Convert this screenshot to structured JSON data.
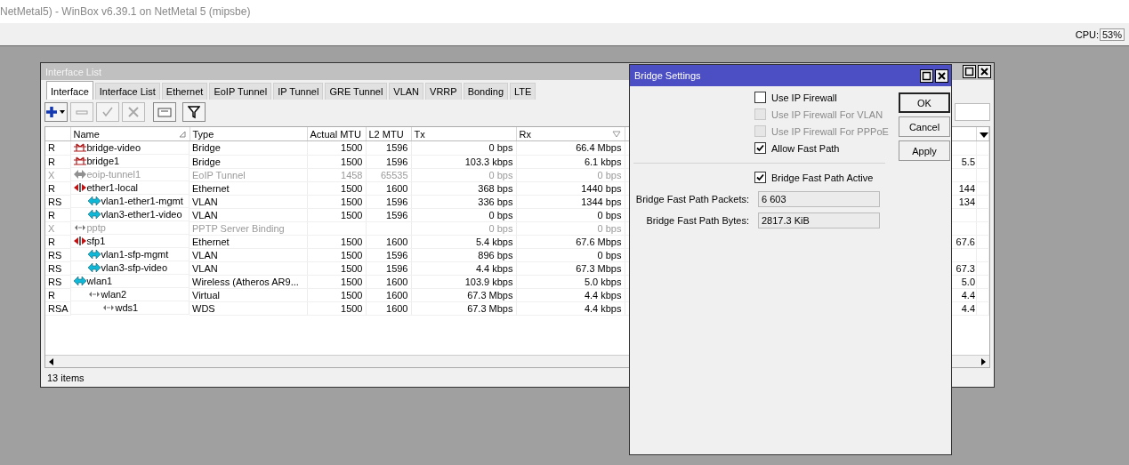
{
  "app_title": "NetMetal5) - WinBox v6.39.1 on NetMetal 5 (mipsbe)",
  "cpu": {
    "label": "CPU:",
    "value": "53%"
  },
  "interface_window": {
    "title": "Interface List",
    "tabs": [
      {
        "label": "Interface",
        "selected": true
      },
      {
        "label": "Interface List",
        "selected": false
      },
      {
        "label": "Ethernet",
        "selected": false
      },
      {
        "label": "EoIP Tunnel",
        "selected": false
      },
      {
        "label": "IP Tunnel",
        "selected": false
      },
      {
        "label": "GRE Tunnel",
        "selected": false
      },
      {
        "label": "VLAN",
        "selected": false
      },
      {
        "label": "VRRP",
        "selected": false
      },
      {
        "label": "Bonding",
        "selected": false
      },
      {
        "label": "LTE",
        "selected": false
      }
    ],
    "toolbar": [
      {
        "kind": "add",
        "disabled": false
      },
      {
        "kind": "remove",
        "disabled": true
      },
      {
        "kind": "enable",
        "disabled": true
      },
      {
        "kind": "disable",
        "disabled": true
      },
      {
        "kind": "comment",
        "disabled": false
      },
      {
        "kind": "filter",
        "disabled": false
      }
    ],
    "columns": [
      "Name",
      "Type",
      "Actual MTU",
      "L2 MTU",
      "Tx",
      "Rx"
    ],
    "rows": [
      {
        "flags": "R",
        "name": "bridge-video",
        "kind": "bridge",
        "disabled": false,
        "type": "Bridge",
        "actual_mtu": "1500",
        "l2_mtu": "1596",
        "tx": "0 bps",
        "rx": "66.4 Mbps"
      },
      {
        "flags": "R",
        "name": "bridge1",
        "kind": "bridge",
        "disabled": false,
        "type": "Bridge",
        "actual_mtu": "1500",
        "l2_mtu": "1596",
        "tx": "103.3 kbps",
        "rx": "6.1 kbps",
        "column_7": "5.5"
      },
      {
        "flags": "X",
        "name": "eoip-tunnel1",
        "kind": "tunnel",
        "disabled": true,
        "type": "EoIP Tunnel",
        "actual_mtu": "1458",
        "l2_mtu": "65535",
        "tx": "0 bps",
        "rx": "0 bps"
      },
      {
        "flags": "R",
        "name": "ether1-local",
        "kind": "ethernet",
        "disabled": false,
        "type": "Ethernet",
        "actual_mtu": "1500",
        "l2_mtu": "1600",
        "tx": "368 bps",
        "rx": "1440 bps",
        "column_7": "144",
        "children": [
          {
            "flags": "RS",
            "name": "vlan1-ether1-mgmt",
            "kind": "vlan",
            "disabled": false,
            "type": "VLAN",
            "actual_mtu": "1500",
            "l2_mtu": "1596",
            "tx": "336 bps",
            "rx": "1344 bps",
            "column_7": "134"
          },
          {
            "flags": "R",
            "name": "vlan3-ether1-video",
            "kind": "vlan",
            "disabled": false,
            "type": "VLAN",
            "actual_mtu": "1500",
            "l2_mtu": "1596",
            "tx": "0 bps",
            "rx": "0 bps"
          }
        ]
      },
      {
        "flags": "X",
        "name": "pptp",
        "kind": "link",
        "disabled": true,
        "type": "PPTP Server Binding",
        "tx": "0 bps",
        "rx": "0 bps"
      },
      {
        "flags": "R",
        "name": "sfp1",
        "kind": "ethernet",
        "disabled": false,
        "type": "Ethernet",
        "actual_mtu": "1500",
        "l2_mtu": "1600",
        "tx": "5.4 kbps",
        "rx": "67.6 Mbps",
        "column_7": "67.6",
        "children": [
          {
            "flags": "RS",
            "name": "vlan1-sfp-mgmt",
            "kind": "vlan",
            "disabled": false,
            "type": "VLAN",
            "actual_mtu": "1500",
            "l2_mtu": "1596",
            "tx": "896 bps",
            "rx": "0 bps"
          },
          {
            "flags": "RS",
            "name": "vlan3-sfp-video",
            "kind": "vlan",
            "disabled": false,
            "type": "VLAN",
            "actual_mtu": "1500",
            "l2_mtu": "1596",
            "tx": "4.4 kbps",
            "rx": "67.3 Mbps",
            "column_7": "67.3"
          }
        ]
      },
      {
        "flags": "RS",
        "name": "wlan1",
        "kind": "vlan",
        "disabled": false,
        "type": "Wireless (Atheros AR9...",
        "actual_mtu": "1500",
        "l2_mtu": "1600",
        "tx": "103.9 kbps",
        "rx": "5.0 kbps",
        "column_7": "5.0",
        "children": [
          {
            "flags": "R",
            "name": "wlan2",
            "kind": "link",
            "disabled": false,
            "type": "Virtual",
            "actual_mtu": "1500",
            "l2_mtu": "1600",
            "tx": "67.3 Mbps",
            "rx": "4.4 kbps",
            "column_7": "4.4",
            "children": [
              {
                "flags": "RSA",
                "name": "wds1",
                "kind": "link",
                "disabled": false,
                "type": "WDS",
                "actual_mtu": "1500",
                "l2_mtu": "1600",
                "tx": "67.3 Mbps",
                "rx": "4.4 kbps",
                "column_7": "4.4"
              }
            ]
          }
        ]
      }
    ],
    "status": "13 items"
  },
  "bridge_settings": {
    "title": "Bridge Settings",
    "checkboxes": [
      {
        "label": "Use IP Firewall",
        "checked": false,
        "disabled": false
      },
      {
        "label": "Use IP Firewall For VLAN",
        "checked": false,
        "disabled": true
      },
      {
        "label": "Use IP Firewall For PPPoE",
        "checked": false,
        "disabled": true
      },
      {
        "label": "Allow Fast Path",
        "checked": true,
        "disabled": false
      }
    ],
    "status_checkbox": {
      "label": "Bridge Fast Path Active",
      "checked": true,
      "disabled": false
    },
    "fields": [
      {
        "label": "Bridge Fast Path Packets:",
        "value": "6 603"
      },
      {
        "label": "Bridge Fast Path Bytes:",
        "value": "2817.3 KiB"
      }
    ],
    "buttons": [
      "OK",
      "Cancel",
      "Apply"
    ]
  }
}
